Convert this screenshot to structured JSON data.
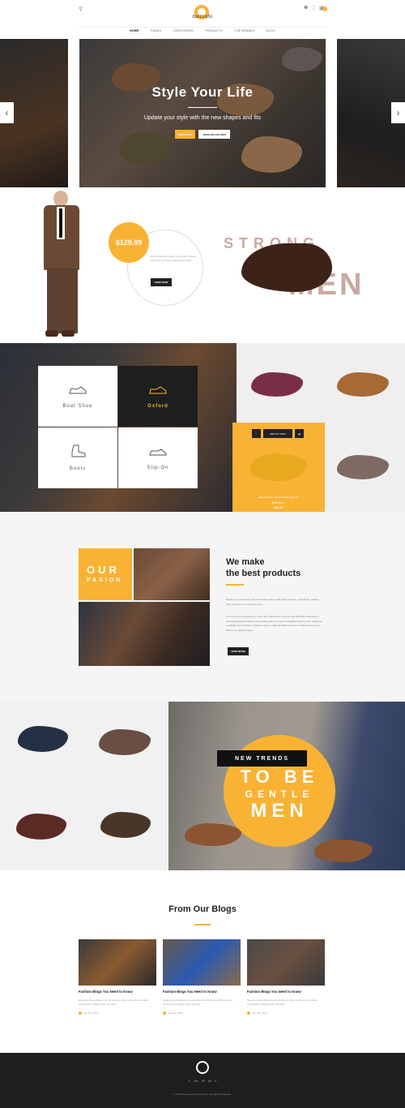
{
  "header": {
    "logo_text": "mercato",
    "cart_count": "0",
    "nav": [
      "HOME",
      "PAGES",
      "CATEGORIES",
      "PRODUCTS",
      "TOP BRANDS",
      "BLOG"
    ]
  },
  "hero": {
    "title": "Style Your Life",
    "subtitle": "Update your style with the new shapes and fits",
    "btn_shop": "SHOP NOW",
    "btn_collection": "VIEW COLLECTION",
    "prev_icon": "‹",
    "next_icon": "›"
  },
  "promo": {
    "price": "$129.99",
    "description": "100% Italian European luxe leather Shoes Monk will get finest Casual Monk Sale",
    "btn": "SHOP NOW",
    "strong": "STRONG",
    "men": "MEN"
  },
  "categories": {
    "tiles": [
      {
        "label": "Boat Shoe"
      },
      {
        "label": "Oxford"
      },
      {
        "label": "Boots"
      },
      {
        "label": "Slip-On"
      }
    ],
    "product": {
      "add_to_cart": "ADD TO CART",
      "name": "Men's Classic Oxford Suede Brogues",
      "price": "$57.00",
      "rating": 4
    }
  },
  "about": {
    "our": "OUR",
    "pasion": "PASION",
    "title_line1": "We make",
    "title_line2": "the best products",
    "para1": "Neque porro quisquam est qui dolorem ipsum quia dolor sit amet, consectetur, adipisci velit, sed quia non numquam eius.",
    "para2": "At vero eos et accusamus et iusto odio dignissimos ducimus qui blanditiis praesentium voluptatum deleniti atque corrupti quos dolores et quas molestias excepturi sint occaecati cupiditate non provident, similique sunt in culpa qui officia deserunt mollitia animi, id est laborum et dolorum fuga.",
    "btn": "VIEW MORE"
  },
  "trends": {
    "label": "NEW TRENDS",
    "line1": "TO BE",
    "line2": "GENTLE",
    "line3": "MEN"
  },
  "blogs": {
    "title": "From Our Blogs",
    "posts": [
      {
        "title": "Fashion Blogs You Need to Know",
        "excerpt": "Neque porro quisquam est qui dolorem ipsum quia dolor sit amet, consectetur, adipisci velit, sed quia.",
        "date": "JUL 06 | 2016"
      },
      {
        "title": "Fashion Blogs You Need to Know",
        "excerpt": "Neque porro quisquam est qui dolorem ipsum quia dolor sit amet, consectetur, adipisci velit, sed quia.",
        "date": "JUL 06 | 2016"
      },
      {
        "title": "Fashion Blogs You Need to Know",
        "excerpt": "Neque porro quisquam est qui dolorem ipsum quia dolor sit amet, consectetur, adipisci velit, sed quia.",
        "date": "JUL 06 | 2016"
      }
    ]
  },
  "footer": {
    "social": [
      "f",
      "G+",
      "P",
      "in",
      "t"
    ],
    "copyright": "© 2016 Emmercato Demo Store. All Rights Reserved."
  },
  "colors": {
    "accent": "#f9b233",
    "dark": "#1e1e1e"
  }
}
